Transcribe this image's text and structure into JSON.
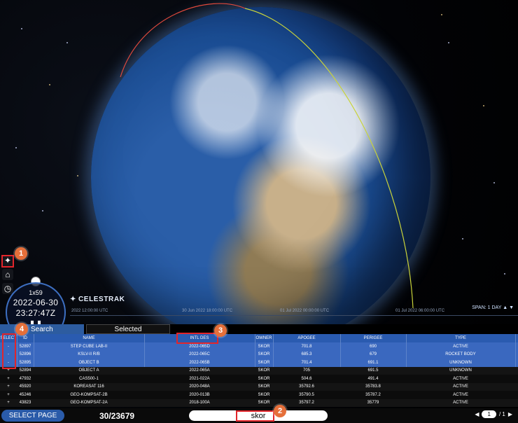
{
  "app": {
    "logo_text": "CELESTRAK",
    "logo_icon": "satellite-logo-icon"
  },
  "side_icons": [
    {
      "name": "satellite-toggle-icon",
      "glyph": "✦"
    },
    {
      "name": "home-icon",
      "glyph": "⌂"
    },
    {
      "name": "clock-icon",
      "glyph": "◷"
    }
  ],
  "clock": {
    "rate": "1x59",
    "date": "2022-06-30",
    "time": "23:27:47Z",
    "pause_glyph": "❚❚"
  },
  "timeline": {
    "labels": [
      "2022 12:00:00 UTC",
      "30 Jun 2022 18:00:00 UTC",
      "01 Jul 2022 00:00:00 UTC",
      "01 Jul 2022 06:00:00 UTC"
    ],
    "span_label": "SPAN: 1 DAY"
  },
  "callouts": [
    "1",
    "2",
    "3",
    "4"
  ],
  "tabs": {
    "search": "Search",
    "selected": "Selected"
  },
  "table": {
    "headers": [
      "SELECT",
      "ID",
      "NAME",
      "INTL DES",
      "OWNER",
      "APOGEE",
      "PERIGEE",
      "TYPE"
    ],
    "rows": [
      {
        "sel": "-",
        "id": "52897",
        "name": "STEP CUBE LAB-II",
        "intl": "2022-065D",
        "owner": "SKOR",
        "apogee": "701.8",
        "perigee": "690",
        "type": "ACTIVE",
        "selected": true
      },
      {
        "sel": "-",
        "id": "52896",
        "name": "KSLV-II R/B",
        "intl": "2022-065C",
        "owner": "SKOR",
        "apogee": "685.3",
        "perigee": "679",
        "type": "ROCKET BODY",
        "selected": true
      },
      {
        "sel": "-",
        "id": "52895",
        "name": "OBJECT B",
        "intl": "2022-065B",
        "owner": "SKOR",
        "apogee": "701.4",
        "perigee": "691.1",
        "type": "UNKNOWN",
        "selected": true
      },
      {
        "sel": "+",
        "id": "52894",
        "name": "OBJECT A",
        "intl": "2022-065A",
        "owner": "SKOR",
        "apogee": "705",
        "perigee": "691.5",
        "type": "UNKNOWN",
        "selected": false
      },
      {
        "sel": "+",
        "id": "47932",
        "name": "CAS500-1",
        "intl": "2021-022A",
        "owner": "SKOR",
        "apogee": "504.6",
        "perigee": "491.4",
        "type": "ACTIVE",
        "selected": false
      },
      {
        "sel": "+",
        "id": "45920",
        "name": "KOREASAT 116",
        "intl": "2020-048A",
        "owner": "SKOR",
        "apogee": "35792.6",
        "perigee": "35783.8",
        "type": "ACTIVE",
        "selected": false
      },
      {
        "sel": "+",
        "id": "45246",
        "name": "GEO-KOMPSAT-2B",
        "intl": "2020-013B",
        "owner": "SKOR",
        "apogee": "35790.5",
        "perigee": "35787.2",
        "type": "ACTIVE",
        "selected": false
      },
      {
        "sel": "+",
        "id": "43823",
        "name": "GEO-KOMPSAT-2A",
        "intl": "2018-100A",
        "owner": "SKOR",
        "apogee": "35797.2",
        "perigee": "35779",
        "type": "ACTIVE",
        "selected": false
      }
    ]
  },
  "footer": {
    "select_page": "SELECT PAGE",
    "count": "30/23679",
    "search_value": "skor",
    "page_current": "1",
    "page_total": "/ 1"
  }
}
